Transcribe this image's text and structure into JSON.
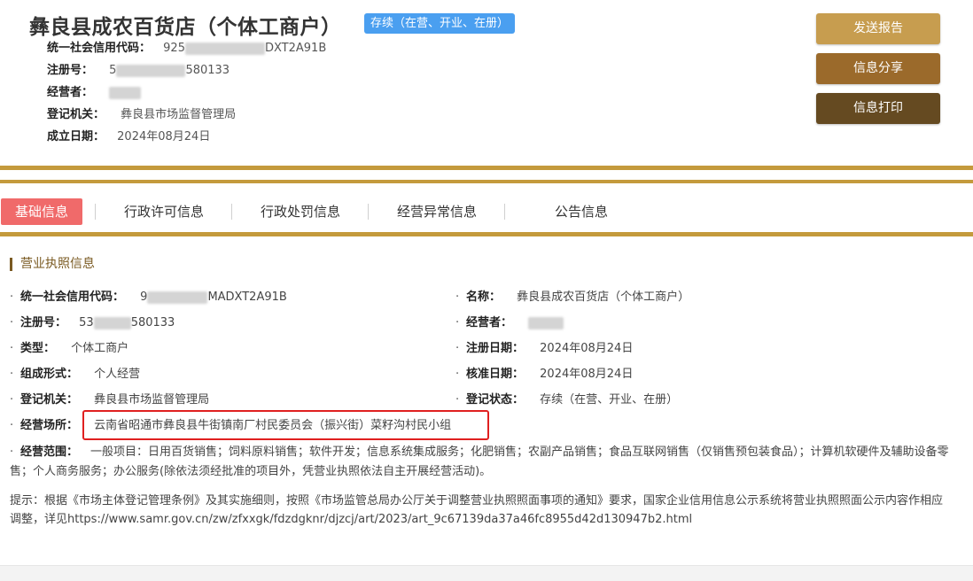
{
  "header": {
    "title": "彝良县成农百货店（个体工商户）",
    "status_badge": "存续（在营、开业、在册）",
    "credit_code_label": "统一社会信用代码：",
    "credit_code_prefix": "925",
    "credit_code_suffix": "DXT2A91B",
    "reg_no_label": "注册号：",
    "reg_no_prefix": "5",
    "reg_no_suffix": "580133",
    "operator_label": "经营者：",
    "operator_tail": "",
    "authority_label": "登记机关：",
    "authority_value": "彝良县市场监督管理局",
    "founded_label": "成立日期：",
    "founded_value": "2024年08月24日"
  },
  "actions": {
    "send_report": "发送报告",
    "share_info": "信息分享",
    "print_info": "信息打印"
  },
  "tabs": [
    {
      "label": "基础信息",
      "active": true
    },
    {
      "label": "行政许可信息",
      "active": false
    },
    {
      "label": "行政处罚信息",
      "active": false
    },
    {
      "label": "经营异常信息",
      "active": false
    },
    {
      "label": "公告信息",
      "active": false
    }
  ],
  "section": {
    "title": "营业执照信息"
  },
  "license": {
    "credit_code": {
      "label": "统一社会信用代码：",
      "prefix": "9",
      "suffix": "MADXT2A91B"
    },
    "name": {
      "label": "名称：",
      "value": "彝良县成农百货店（个体工商户）"
    },
    "reg_no": {
      "label": "注册号：",
      "prefix": "53",
      "suffix": "580133"
    },
    "operator": {
      "label": "经营者：",
      "tail": ""
    },
    "type": {
      "label": "类型：",
      "value": "个体工商户"
    },
    "reg_date": {
      "label": "注册日期：",
      "value": "2024年08月24日"
    },
    "composition": {
      "label": "组成形式：",
      "value": "个人经营"
    },
    "approval_date": {
      "label": "核准日期：",
      "value": "2024年08月24日"
    },
    "authority": {
      "label": "登记机关：",
      "value": "彝良县市场监督管理局"
    },
    "reg_status": {
      "label": "登记状态：",
      "value": "存续（在营、开业、在册）"
    },
    "address": {
      "label": "经营场所：",
      "value": "云南省昭通市彝良县牛街镇南厂村民委员会（振兴街）菜籽沟村民小组"
    },
    "scope": {
      "label": "经营范围：",
      "value": "一般项目：日用百货销售；饲料原料销售；软件开发；信息系统集成服务；化肥销售；农副产品销售；食品互联网销售（仅销售预包装食品）；计算机软硬件及辅助设备零售；个人商务服务；办公服务(除依法须经批准的项目外，凭营业执照依法自主开展经营活动)。"
    }
  },
  "note": "提示：根据《市场主体登记管理条例》及其实施细则，按照《市场监管总局办公厅关于调整营业执照照面事项的通知》要求，国家企业信用信息公示系统将营业执照照面公示内容作相应调整，详见https://www.samr.gov.cn/zw/zfxxgk/fdzdgknr/djzcj/art/2023/art_9c67139da37a46fc8955d42d130947b2.html",
  "colors": {
    "accent_gold": "#c49a3c",
    "active_tab": "#f06a6a",
    "status_badge": "#4a9ff0",
    "highlight_box": "#e02020"
  }
}
